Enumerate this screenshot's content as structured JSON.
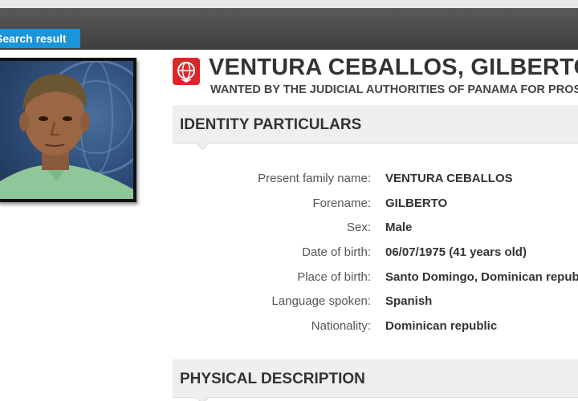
{
  "header": {
    "search_tab_label": "Search result"
  },
  "notice": {
    "name": "VENTURA CEBALLOS, GILBERTO",
    "wanted_line": "WANTED BY THE JUDICIAL AUTHORITIES OF PANAMA FOR PROSECUTION"
  },
  "sections": {
    "identity": "IDENTITY PARTICULARS",
    "physical": "PHYSICAL DESCRIPTION"
  },
  "identity": {
    "rows": [
      {
        "label": "Present family name:",
        "value": "VENTURA CEBALLOS"
      },
      {
        "label": "Forename:",
        "value": "GILBERTO"
      },
      {
        "label": "Sex:",
        "value": "Male"
      },
      {
        "label": "Date of birth:",
        "value": "06/07/1975 (41 years old)"
      },
      {
        "label": "Place of birth:",
        "value": "Santo Domingo, Dominican republic"
      },
      {
        "label": "Language spoken:",
        "value": "Spanish"
      },
      {
        "label": "Nationality:",
        "value": "Dominican republic"
      }
    ]
  },
  "colors": {
    "tab_blue": "#1b94d8",
    "emblem_red": "#d9262b",
    "topbar": "#444444"
  },
  "icons": {
    "emblem": "interpol-emblem-icon",
    "photo": "wanted-person-photo"
  }
}
